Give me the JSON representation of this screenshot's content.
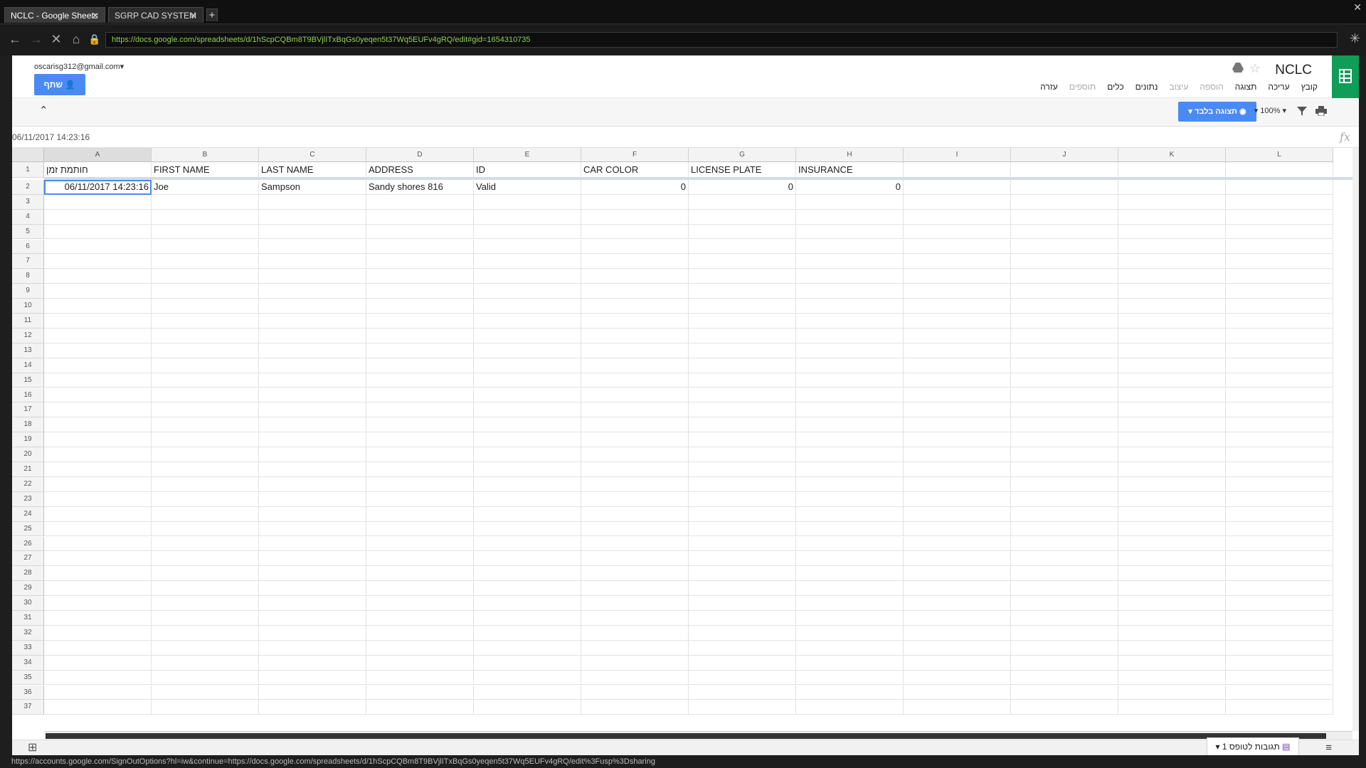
{
  "browser": {
    "tabs": [
      {
        "label": "NCLC - Google Sheets",
        "active": true
      },
      {
        "label": "SGRP CAD SYSTEM",
        "active": false
      }
    ],
    "url": "https://docs.google.com/spreadsheets/d/1hScpCQBm8T9BVjlITxBqGs0yeqen5t37Wq5EUFv4gRQ/edit#gid=1654310735",
    "status_url": "https://accounts.google.com/SignOutOptions?hl=iw&continue=https://docs.google.com/spreadsheets/d/1hScpCQBm8T9BVjlITxBqGs0yeqen5t37Wq5EUFv4gRQ/edit%3Fusp%3Dsharing"
  },
  "header": {
    "account": "oscarisg312@gmail.com",
    "share_label": "שתף",
    "title": "NCLC",
    "menu": [
      {
        "label": "קובץ",
        "dim": false
      },
      {
        "label": "עריכה",
        "dim": false
      },
      {
        "label": "תצוגה",
        "dim": false
      },
      {
        "label": "הוספה",
        "dim": true
      },
      {
        "label": "עיצוב",
        "dim": true
      },
      {
        "label": "נתונים",
        "dim": false
      },
      {
        "label": "כלים",
        "dim": false
      },
      {
        "label": "תוספים",
        "dim": true
      },
      {
        "label": "עזרה",
        "dim": false
      }
    ]
  },
  "toolbar": {
    "view_only_label": "תצוגה בלבד",
    "zoom": "100%"
  },
  "formula_bar": {
    "value": "06/11/2017 14:23:16",
    "fx": "fx"
  },
  "grid": {
    "columns": [
      "A",
      "B",
      "C",
      "D",
      "E",
      "F",
      "G",
      "H",
      "I",
      "J",
      "K",
      "L"
    ],
    "rows_visible": 37,
    "header_row": [
      "חותמת זמן",
      "FIRST NAME",
      "LAST NAME",
      "ADDRESS",
      "ID",
      "CAR COLOR",
      "LICENSE PLATE",
      "INSURANCE",
      "",
      "",
      "",
      ""
    ],
    "data_rows": [
      [
        "06/11/2017 14:23:16",
        "Joe",
        "Sampson",
        "Sandy shores 816",
        "Valid",
        "0",
        "0",
        "0",
        "",
        "",
        "",
        ""
      ]
    ]
  },
  "bottom": {
    "responses_tab": "תגובות לטופס 1"
  },
  "colors": {
    "accent": "#4a8af4",
    "sheets_green": "#0f9d58",
    "url_green": "#8fcf5a"
  }
}
